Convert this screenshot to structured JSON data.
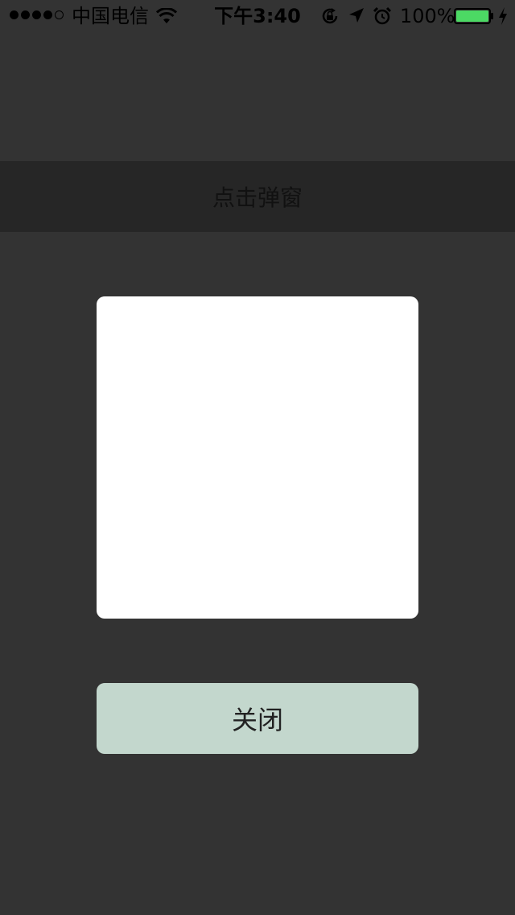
{
  "status_bar": {
    "carrier": "中国电信",
    "time": "下午3:40",
    "battery_percent": "100%",
    "battery_level": 1.0,
    "signal_bars_filled": 4,
    "signal_bars_total": 5,
    "icons": [
      "wifi-icon",
      "rotation-lock-icon",
      "location-icon",
      "alarm-icon",
      "battery-icon",
      "charging-icon"
    ],
    "battery_color": "#4cd964"
  },
  "header": {
    "button_label": "点击弹窗"
  },
  "popup": {
    "close_label": "关闭",
    "close_color": "#c3d7cd"
  },
  "colors": {
    "background": "#333333",
    "header_bg": "#262626",
    "popup_bg": "#ffffff"
  }
}
